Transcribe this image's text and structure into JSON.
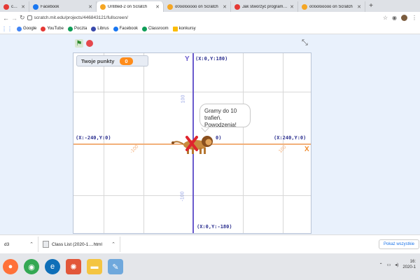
{
  "browser": {
    "tabs": [
      {
        "label": "co...",
        "icon": "rec-icon",
        "color": "#e53935",
        "active": false
      },
      {
        "label": "Facebook",
        "icon": "facebook-icon",
        "color": "#1877f2",
        "active": false
      },
      {
        "label": "Untitled-2 on Scratch",
        "icon": "scratch-icon",
        "color": "#f5a623",
        "active": true
      },
      {
        "label": "o0oolooooo on Scratch",
        "icon": "scratch-icon",
        "color": "#f5a623",
        "active": false
      },
      {
        "label": "Jak stworzyć program o...",
        "icon": "youtube-icon",
        "color": "#e53935",
        "active": false
      },
      {
        "label": "o0oolooooo on Scratch",
        "icon": "scratch-icon",
        "color": "#f5a623",
        "active": false
      }
    ],
    "new_tab_label": "+",
    "url": "scratch.mit.edu/projects/446843121/fullscreen/",
    "bookmarks": [
      {
        "label": "Google",
        "color": "#4285f4"
      },
      {
        "label": "YouTube",
        "color": "#e53935"
      },
      {
        "label": "Poczta",
        "color": "#0f9d58"
      },
      {
        "label": "Librus",
        "color": "#3949ab"
      },
      {
        "label": "Facebook",
        "color": "#1877f2"
      },
      {
        "label": "Classroom",
        "color": "#0f9d58"
      },
      {
        "label": "konkursy",
        "color": "#fbbc05"
      }
    ]
  },
  "scratch": {
    "score_label": "Twoje punkty",
    "score_value": "0",
    "speech_line1": "Gramy do 10 trafień.",
    "speech_line2": "Powodzenia!",
    "axis_x_label": "X",
    "axis_y_label": "Y",
    "coords": {
      "top": "(X:0,Y:180)",
      "bottom": "(X:0,Y:-180)",
      "left": "(X:-240,Y:0)",
      "right": "(X:240,Y:0)",
      "center": "0)"
    },
    "ticks": {
      "x_neg": "-100",
      "x_pos": "100",
      "y_pos": "100",
      "y_neg": "-100"
    }
  },
  "downloads": {
    "item1": "d3",
    "item2": "Class List (2020-1....html",
    "show_all": "Pokaż wszystkie"
  },
  "taskbar": {
    "time": "16:",
    "date": "2020-1"
  }
}
